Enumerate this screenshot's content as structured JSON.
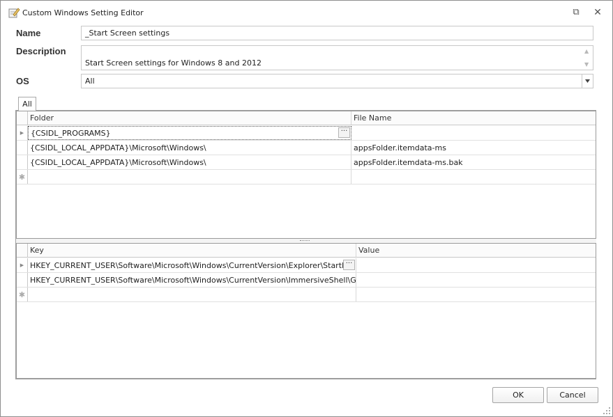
{
  "window": {
    "title": "Custom Windows Setting Editor",
    "restore_symbol": "⧉",
    "close_symbol": "✕"
  },
  "form": {
    "name_label": "Name",
    "name_value": "_Start Screen settings",
    "description_label": "Description",
    "description_value": "Start Screen settings for Windows 8 and 2012",
    "os_label": "OS",
    "os_value": "All"
  },
  "tabs": [
    {
      "label": "All",
      "selected": true
    }
  ],
  "folders_grid": {
    "columns": [
      "Folder",
      "File Name"
    ],
    "rows": [
      {
        "folder": "{CSIDL_PROGRAMS}",
        "file": ""
      },
      {
        "folder": "{CSIDL_LOCAL_APPDATA}\\Microsoft\\Windows\\",
        "file": "appsFolder.itemdata-ms"
      },
      {
        "folder": "{CSIDL_LOCAL_APPDATA}\\Microsoft\\Windows\\",
        "file": "appsFolder.itemdata-ms.bak"
      }
    ],
    "ellipsis_label": "···"
  },
  "registry_grid": {
    "columns": [
      "Key",
      "Value"
    ],
    "rows": [
      {
        "key": "HKEY_CURRENT_USER\\Software\\Microsoft\\Windows\\CurrentVersion\\Explorer\\StartPage",
        "value": ""
      },
      {
        "key": "HKEY_CURRENT_USER\\Software\\Microsoft\\Windows\\CurrentVersion\\ImmersiveShell\\Grid",
        "value": ""
      }
    ],
    "ellipsis_label": "···"
  },
  "grid_markers": {
    "current_row": "▶",
    "new_row": "✱"
  },
  "buttons": {
    "ok": "OK",
    "cancel": "Cancel"
  },
  "icons": {
    "title": "editor-note-icon",
    "dropdown": "chevron-down-icon"
  },
  "colors": {
    "border": "#a0a0a0",
    "header_bg": "#fbfbfb"
  }
}
